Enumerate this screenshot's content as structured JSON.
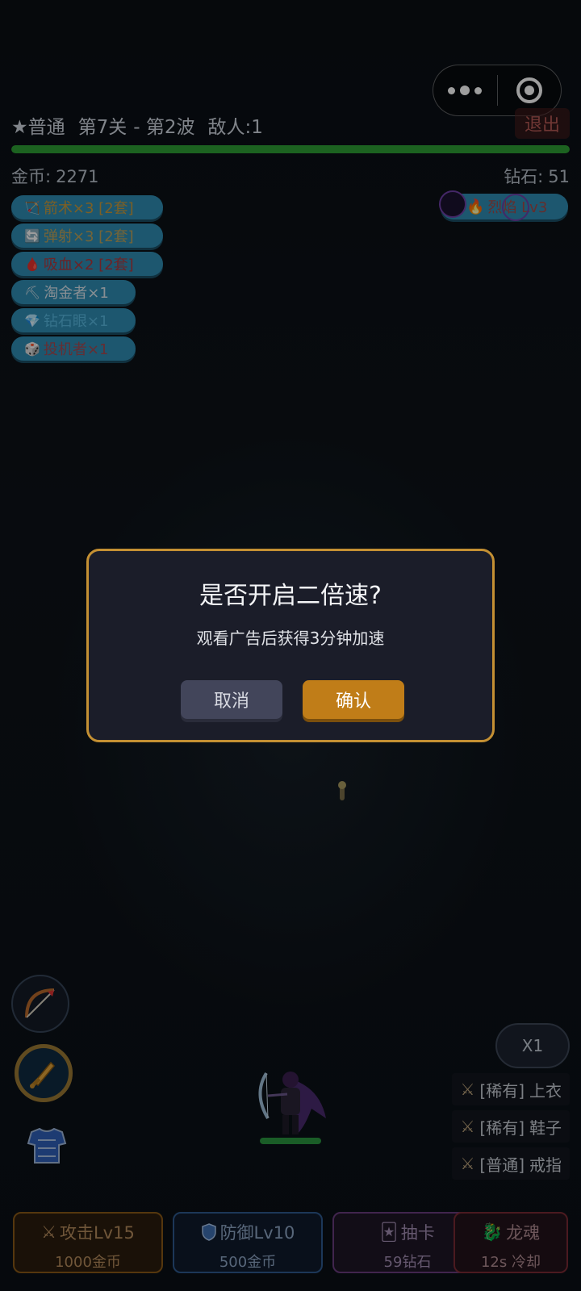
{
  "header": {
    "difficulty": "★普通",
    "stage": "第7关",
    "wave": "- 第2波",
    "enemies": "敌人:1",
    "exit_label": "退出",
    "wave_progress": 1.0
  },
  "resources": {
    "gold_label": "金币:",
    "gold_value": "2271",
    "diamond_label": "钻石:",
    "diamond_value": "51"
  },
  "buffs": [
    {
      "icon": "🏹",
      "label": "箭术×3 [2套]",
      "color": "#c89a3c",
      "width": 188
    },
    {
      "icon": "🔄",
      "label": "弹射×3 [2套]",
      "color": "#bda25a",
      "width": 188
    },
    {
      "icon": "🩸",
      "label": "吸血×2 [2套]",
      "color": "#b0373c",
      "width": 188
    },
    {
      "icon": "⛏",
      "label": "淘金者×1",
      "color": "#dbe6ee",
      "width": 154
    },
    {
      "icon": "💎",
      "label": "钻石眼×1",
      "color": "#58b9e0",
      "width": 154
    },
    {
      "icon": "🎲",
      "label": "投机者×1",
      "color": "#a54a52",
      "width": 154
    }
  ],
  "hex_badge": "烈焰 Lv3",
  "dialog": {
    "title": "是否开启二倍速?",
    "message": "观看广告后获得3分钟加速",
    "cancel_label": "取消",
    "confirm_label": "确认"
  },
  "speed_button": "X1",
  "loot": [
    {
      "rarity": "[稀有]",
      "item": "上衣"
    },
    {
      "rarity": "[稀有]",
      "item": "鞋子"
    },
    {
      "rarity": "[普通]",
      "item": "戒指"
    }
  ],
  "upgrades": {
    "attack": {
      "title": "攻击Lv15",
      "cost": "1000金币"
    },
    "defense": {
      "title": "防御Lv10",
      "cost": "500金币"
    },
    "draw": {
      "title": "抽卡",
      "cost": "59钻石"
    },
    "dragon": {
      "title": "龙魂",
      "cost": "12s 冷却"
    }
  },
  "icons": {
    "more": "more-dots-icon",
    "close": "close-miniprogram-icon",
    "sword": "crossed-swords-icon",
    "shield": "shield-icon",
    "card": "card-icon",
    "dragon": "dragon-icon"
  }
}
